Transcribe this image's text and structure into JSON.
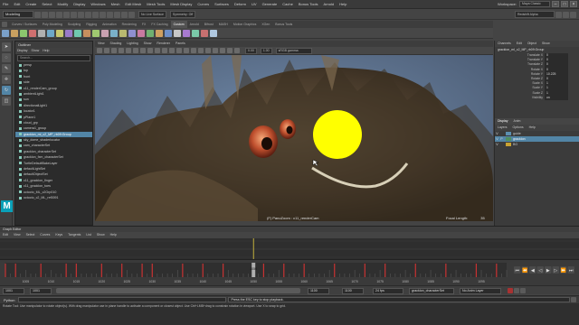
{
  "menubar": {
    "items": [
      "File",
      "Edit",
      "Create",
      "Select",
      "Modify",
      "Display",
      "Windows",
      "Mesh",
      "Edit Mesh",
      "Mesh Tools",
      "Mesh Display",
      "Curves",
      "Surfaces",
      "Deform",
      "UV",
      "Generate",
      "Cache",
      "Bonus Tools",
      "Arnold",
      "Help"
    ],
    "workspace_label": "Workspace:",
    "workspace_value": "Maya Classic"
  },
  "statusline": {
    "mode": "Modeling",
    "no_live_surface": "No Live Surface",
    "symmetry": "Symmetry: Off",
    "render_value": "Redshift Alpha"
  },
  "shelf": {
    "tabs": [
      "Curves / Surfaces",
      "Poly Modeling",
      "Sculpting",
      "Rigging",
      "Animation",
      "Rendering",
      "FX",
      "FX Caching",
      "Custom",
      "Arnold",
      "Bifrost",
      "MASH",
      "Motion Graphics",
      "XGen",
      "Bonus Tools"
    ],
    "active_tab": "Custom",
    "icon_colors": [
      "#7aa0c8",
      "#c8a060",
      "#8cc86e",
      "#d07070",
      "#b0b0b0",
      "#6ea8c8",
      "#c8c86e",
      "#9a7ac8",
      "#70c8b0",
      "#c88f5e",
      "#a0c870",
      "#c8a0b0",
      "#7ab0c8",
      "#b8b870",
      "#8f8fd0",
      "#c87aa0",
      "#70b070",
      "#d0a060",
      "#6e8fc8",
      "#c8c8c8",
      "#a87ad0",
      "#7ac8a8",
      "#c87070",
      "#b0c8e0"
    ]
  },
  "toolbox": {
    "tools": [
      {
        "name": "select-tool-icon",
        "glyph": "➤"
      },
      {
        "name": "lasso-tool-icon",
        "glyph": "◌"
      },
      {
        "name": "paint-select-icon",
        "glyph": "✎"
      },
      {
        "name": "move-tool-icon",
        "glyph": "✛"
      },
      {
        "name": "rotate-tool-icon",
        "glyph": "↻"
      },
      {
        "name": "scale-tool-icon",
        "glyph": "◫"
      }
    ]
  },
  "outliner": {
    "title": "Outliner",
    "menu": [
      "Display",
      "Show",
      "Help"
    ],
    "search_placeholder": "Search...",
    "rows": [
      {
        "label": "persp",
        "selected": false
      },
      {
        "label": "top",
        "selected": false
      },
      {
        "label": "front",
        "selected": false
      },
      {
        "label": "side",
        "selected": false
      },
      {
        "label": "c11_renderCam_group",
        "selected": false
      },
      {
        "label": "ambientLight1",
        "selected": false
      },
      {
        "label": "sun",
        "selected": false
      },
      {
        "label": "directionalLight1",
        "selected": false
      },
      {
        "label": "locator1",
        "selected": false
      },
      {
        "label": "pPlane1",
        "selected": false
      },
      {
        "label": "cloud_grp",
        "selected": false
      },
      {
        "label": "camera1_group",
        "selected": false
      },
      {
        "label": "gracklon_ml_c2_MP_rb09:Group",
        "selected": true
      },
      {
        "label": "sky_dome_shaderlocator",
        "selected": false
      },
      {
        "label": "cam_characterSet",
        "selected": false
      },
      {
        "label": "gracklon_characterSet",
        "selected": false
      },
      {
        "label": "gracklon_fxm_characterSet",
        "selected": false
      },
      {
        "label": "TurtleDefaultBakeLayer",
        "selected": false
      },
      {
        "label": "defaultLightSet",
        "selected": false
      },
      {
        "label": "defaultObjectSet",
        "selected": false
      },
      {
        "label": "c11_gracklon_finger",
        "selected": false
      },
      {
        "label": "c11_gracklon_toes",
        "selected": false
      },
      {
        "label": "octocto_ML_c2Grp010",
        "selected": false
      },
      {
        "label": "octocto_c2_ML_ref0091",
        "selected": false
      }
    ]
  },
  "viewport": {
    "menu": [
      "View",
      "Shading",
      "Lighting",
      "Show",
      "Renderer",
      "Panels"
    ],
    "camera_field": "persp",
    "display_field": "sRGB gamma",
    "val_a": "0.00",
    "val_b": "1.00",
    "hud_camera": "(F) PanoZoom : c11_renderCam",
    "hud_focal_label": "Focal Length:",
    "hud_focal_value": "35",
    "annotation_color": "#ffff00"
  },
  "rightpanel": {
    "header": [
      "Channels",
      "Edit",
      "Object",
      "Show"
    ],
    "object_name": "gracklon_ml_c2_MP_rb09:Group",
    "attrs": [
      {
        "k": "Translate X",
        "v": "0"
      },
      {
        "k": "Translate Y",
        "v": "0"
      },
      {
        "k": "Translate Z",
        "v": "0"
      },
      {
        "k": "Rotate X",
        "v": "0"
      },
      {
        "k": "Rotate Y",
        "v": "10.225"
      },
      {
        "k": "Rotate Z",
        "v": "0"
      },
      {
        "k": "Scale X",
        "v": "1"
      },
      {
        "k": "Scale Y",
        "v": "1"
      },
      {
        "k": "Scale Z",
        "v": "1"
      },
      {
        "k": "Visibility",
        "v": "on"
      }
    ],
    "tabs": [
      "Display",
      "Anim"
    ],
    "layer_menu": [
      "Layers",
      "Options",
      "Help"
    ],
    "layers": [
      {
        "v": "V",
        "p": "",
        "color": "#5c8fb0",
        "label": "guide",
        "selected": false
      },
      {
        "v": "V",
        "p": "P",
        "color": "#4f8f5f",
        "label": "gracklon",
        "selected": true
      },
      {
        "v": "V",
        "p": "",
        "color": "#c9a232",
        "label": "BG",
        "selected": false
      }
    ]
  },
  "graph_editor": {
    "title": "Graph Editor",
    "menu": [
      "Edit",
      "View",
      "Select",
      "Curves",
      "Keys",
      "Tangents",
      "List",
      "Show",
      "Help"
    ]
  },
  "timeline": {
    "start": 1001,
    "end": 1100,
    "current": 1050,
    "tick_labels": [
      "1005",
      "1010",
      "1015",
      "1020",
      "1025",
      "1030",
      "1035",
      "1040",
      "1045",
      "1050",
      "1055",
      "1060",
      "1065",
      "1070",
      "1075",
      "1080",
      "1085",
      "1090",
      "1095"
    ],
    "current_label": "1050",
    "keys": [
      1001,
      1003,
      1008,
      1013,
      1015,
      1020,
      1024,
      1028,
      1030,
      1036,
      1040,
      1044,
      1052,
      1056,
      1060,
      1066,
      1072,
      1076,
      1082,
      1088,
      1094,
      1098
    ]
  },
  "rangebar": {
    "start": "1001",
    "range_start": "1001",
    "range_end": "1100",
    "end": "1100",
    "fps": "24 fps",
    "anim_layer": "No Anim Layer",
    "char_set": "gracklon_characterSet"
  },
  "commandline": {
    "label": "Python",
    "message": "Press the ESC key to stop playback."
  },
  "helpline": {
    "text": "Rotate Tool: Use manipulator to rotate object(s). With drag manipulator use in plane handle to activate a component or closest object. Use Ctrl+LMB+drag to constrain rotation in viewport. Use X to snap to grid."
  }
}
